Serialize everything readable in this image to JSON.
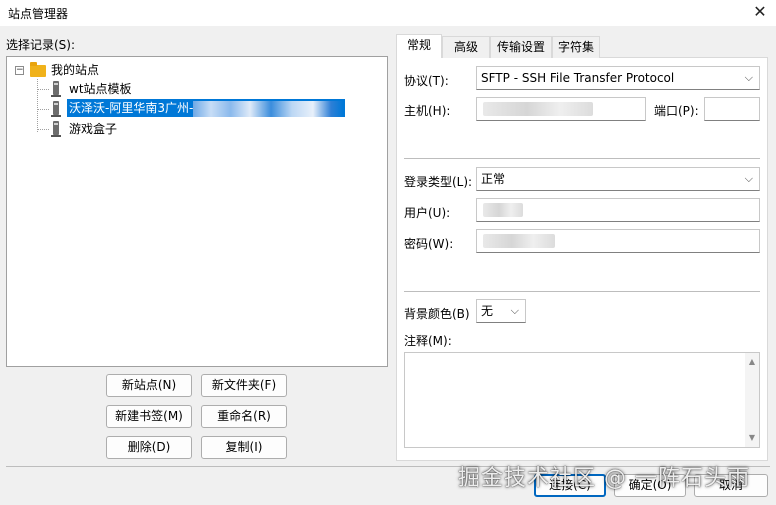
{
  "window": {
    "title": "站点管理器",
    "close_glyph": "✕"
  },
  "tree": {
    "label": "选择记录(S):",
    "expander_glyph": "−",
    "root": {
      "label": "我的站点"
    },
    "items": [
      {
        "label": "wt站点模板",
        "icon": "server-icon",
        "selected": false
      },
      {
        "label": "沃泽沃-阿里华南3广州-",
        "icon": "server-icon",
        "selected": true
      },
      {
        "label": "游戏盒子",
        "icon": "server-icon",
        "selected": false
      }
    ]
  },
  "buttons": {
    "new_site": "新站点(N)",
    "new_folder": "新文件夹(F)",
    "new_bookmark": "新建书签(M)",
    "rename": "重命名(R)",
    "delete": "删除(D)",
    "copy": "复制(I)",
    "connect": "连接(C)",
    "ok": "确定(O)",
    "cancel": "取消"
  },
  "tabs": [
    {
      "label": "常规",
      "active": true
    },
    {
      "label": "高级",
      "active": false
    },
    {
      "label": "传输设置",
      "active": false
    },
    {
      "label": "字符集",
      "active": false
    }
  ],
  "general": {
    "protocol_label": "协议(T):",
    "protocol_value": "SFTP - SSH File Transfer Protocol",
    "host_label": "主机(H):",
    "port_label": "端口(P):",
    "port_value": "",
    "logon_type_label": "登录类型(L):",
    "logon_type_value": "正常",
    "user_label": "用户(U):",
    "password_label": "密码(W):",
    "bg_color_label": "背景颜色(B)",
    "bg_color_value": "无",
    "comments_label": "注释(M):",
    "dropdown_glyph": "⌵",
    "scroll_up_glyph": "▲",
    "scroll_down_glyph": "▼"
  },
  "watermark": "掘金技术社区 @ 一阵石头雨",
  "colors": {
    "selection": "#0078d7",
    "default_button_border": "#0067c0",
    "folder": "#f0b21b"
  }
}
